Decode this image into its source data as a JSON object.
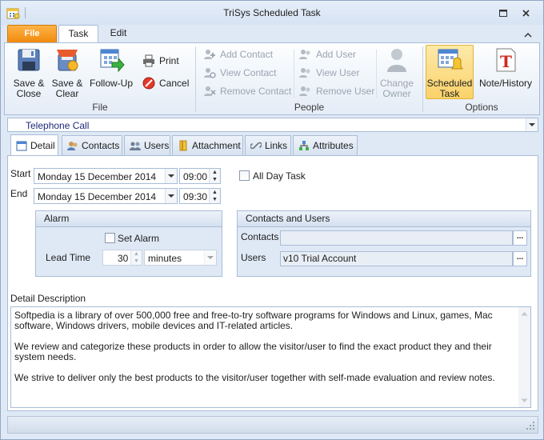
{
  "window": {
    "title": "TriSys Scheduled Task"
  },
  "ribbon": {
    "tabs": [
      {
        "label": "File"
      },
      {
        "label": "Task"
      },
      {
        "label": "Edit"
      }
    ],
    "file_group": {
      "label": "File",
      "save_close": "Save &\nClose",
      "save_clear": "Save &\nClear",
      "follow_up": "Follow-Up",
      "print": "Print",
      "cancel": "Cancel"
    },
    "people_group": {
      "label": "People",
      "add_contact": "Add Contact",
      "view_contact": "View Contact",
      "remove_contact": "Remove Contact",
      "add_user": "Add User",
      "view_user": "View User",
      "remove_user": "Remove User",
      "change_owner": "Change\nOwner"
    },
    "options_group": {
      "label": "Options",
      "scheduled_task": "Scheduled\nTask",
      "note_history": "Note/History"
    }
  },
  "task_type": {
    "value": "Telephone Call"
  },
  "form_tabs": [
    {
      "label": "Detail"
    },
    {
      "label": "Contacts"
    },
    {
      "label": "Users"
    },
    {
      "label": "Attachment"
    },
    {
      "label": "Links"
    },
    {
      "label": "Attributes"
    }
  ],
  "detail": {
    "start_label": "Start",
    "start_date": "Monday 15 December 2014",
    "start_time": "09:00",
    "end_label": "End",
    "end_date": "Monday 15 December 2014",
    "end_time": "09:30",
    "all_day_label": "All Day Task",
    "alarm": {
      "title": "Alarm",
      "set_alarm_label": "Set Alarm",
      "lead_time_label": "Lead Time",
      "lead_time_value": "30",
      "lead_time_unit": "minutes"
    },
    "contacts_users": {
      "title": "Contacts and Users",
      "contacts_label": "Contacts",
      "contacts_value": "",
      "users_label": "Users",
      "users_value": "v10 Trial Account",
      "ellipsis": "..."
    },
    "description_label": "Detail Description",
    "description": [
      "Softpedia is a library of over 500,000 free and free-to-try software programs for Windows and Linux, games, Mac software, Windows drivers, mobile devices and IT-related articles.",
      "We review and categorize these products in order to allow the visitor/user to find the exact product they and their system needs.",
      "We strive to deliver only the best products to the visitor/user together with self-made evaluation and review notes."
    ]
  }
}
